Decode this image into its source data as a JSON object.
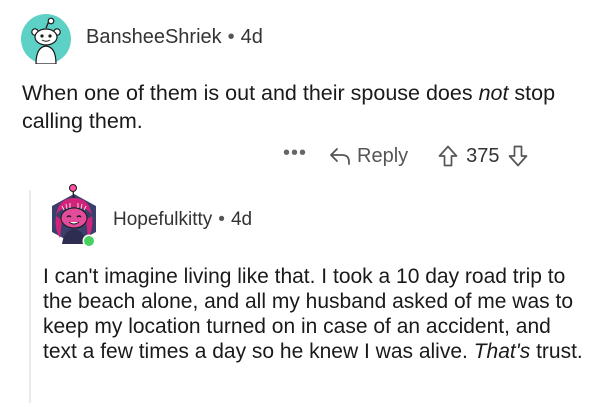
{
  "comments": [
    {
      "username": "BansheeShriek",
      "separator": "•",
      "age": "4d",
      "body_lead": "When one of them is out and their spouse does ",
      "body_emphasis": "not",
      "body_tail": " stop calling them.",
      "actions": {
        "more_label": "•••",
        "reply_label": "Reply",
        "score": "375"
      }
    },
    {
      "username": "Hopefulkitty",
      "separator": "•",
      "age": "4d",
      "body_lead": "I can't imagine living like that. I took a 10 day road trip to the beach alone, and all my husband asked of me was to keep my location turned on in case of an accident, and text a few times a day so he knew I was alive. ",
      "body_emphasis": "That's",
      "body_tail": " trust."
    }
  ],
  "icons": {
    "avatar1": "reddit-snoo-avatar-icon",
    "avatar2": "snoo-avatar-pink-hair-icon",
    "more": "more-options-icon",
    "reply": "reply-arrow-icon",
    "upvote": "upvote-arrow-icon",
    "downvote": "downvote-arrow-icon",
    "online": "online-status-icon"
  },
  "colors": {
    "avatar1_bg": "#5ed1c6",
    "avatar2_bg": "#3a3f6b",
    "online_dot": "#46d160",
    "text": "#1a1a1b",
    "muted": "#555555"
  }
}
